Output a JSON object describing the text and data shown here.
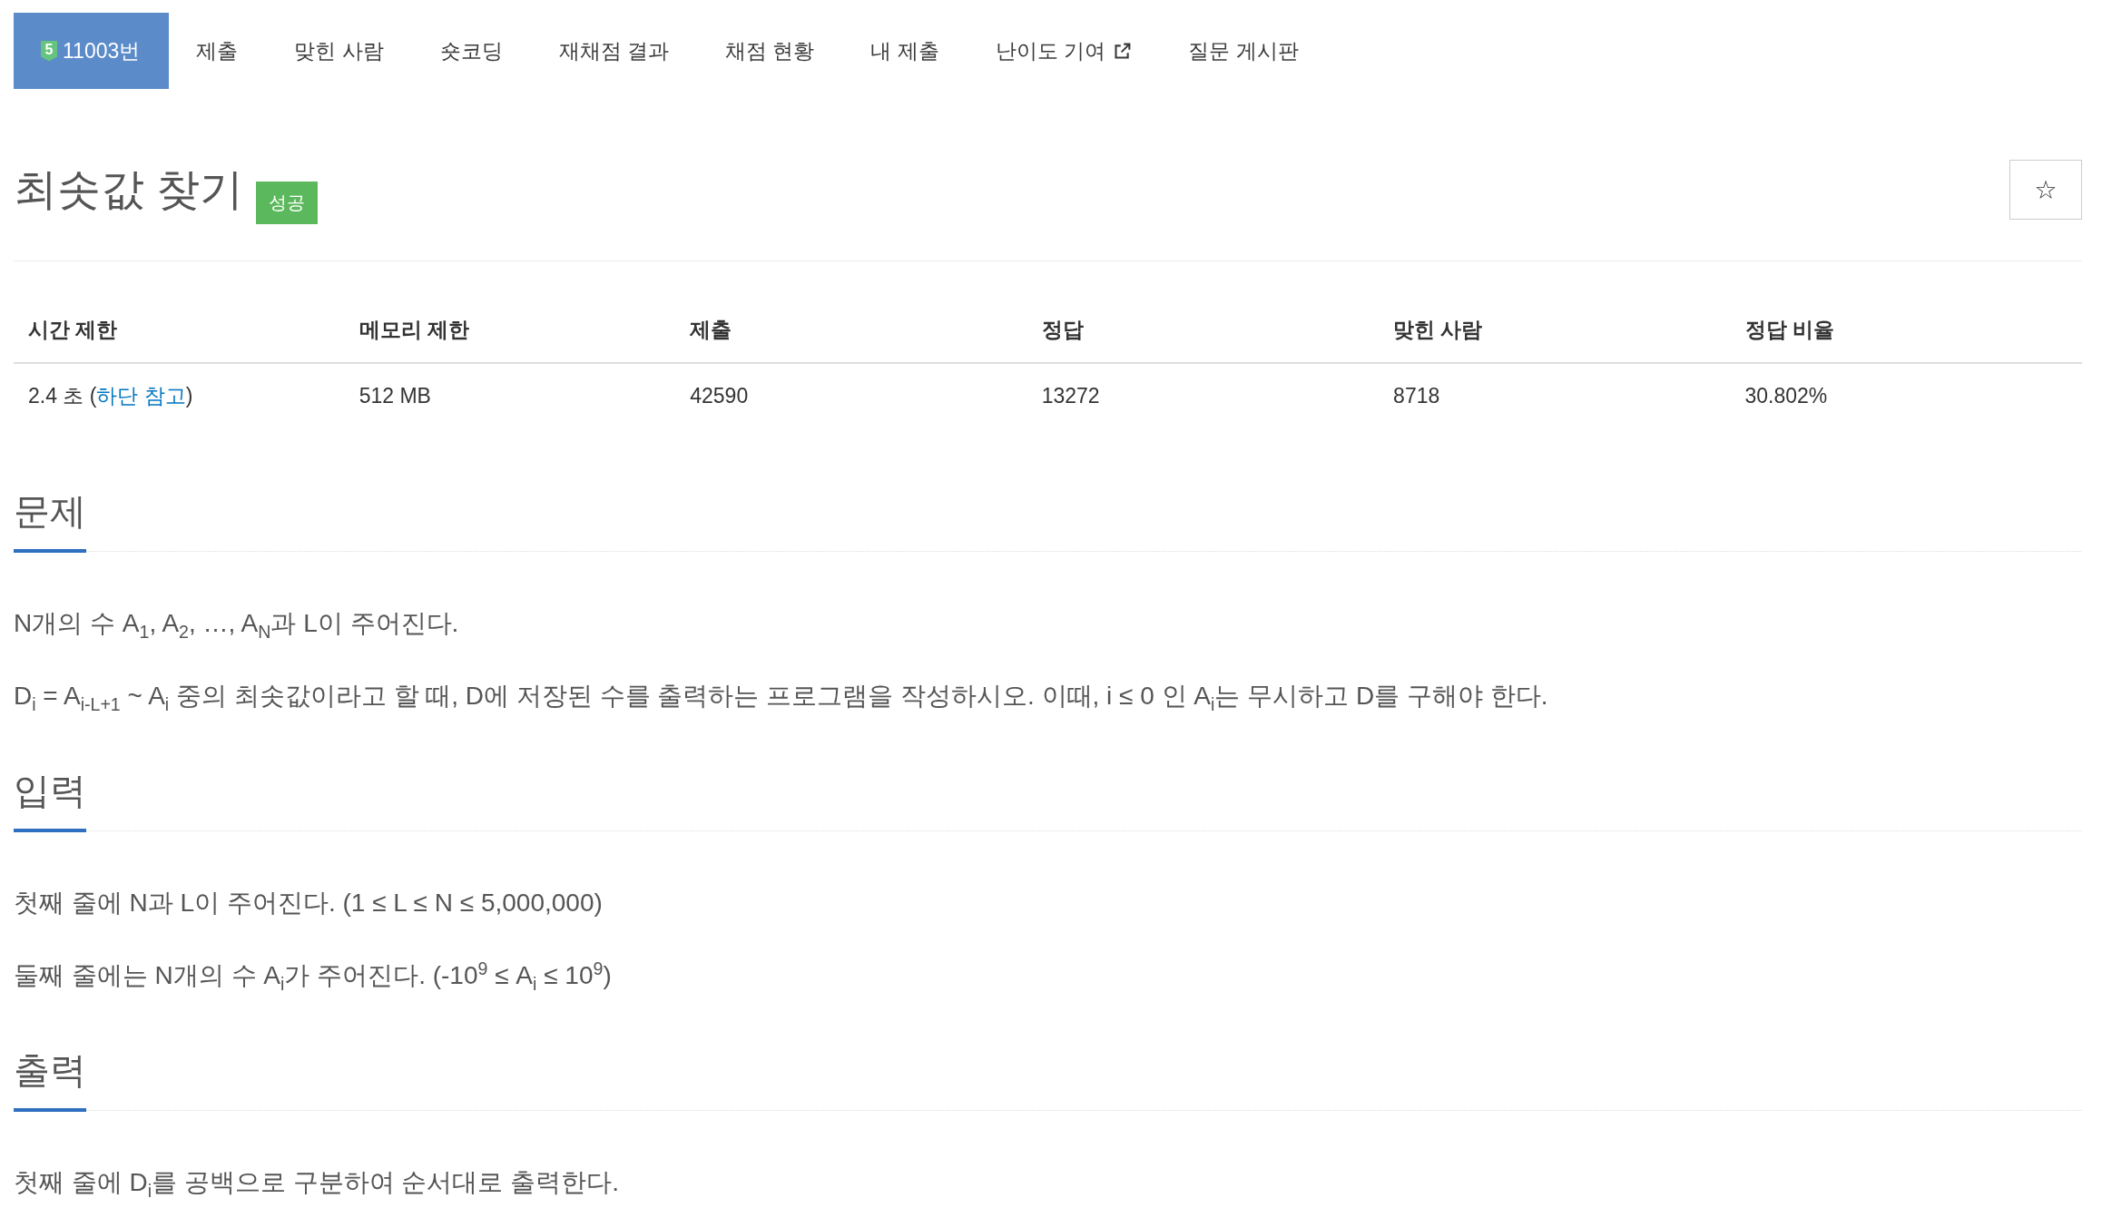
{
  "nav": {
    "tabs": [
      {
        "label": "11003번",
        "badge": "5",
        "selected": true
      },
      {
        "label": "제출",
        "selected": false
      },
      {
        "label": "맞힌 사람",
        "selected": false
      },
      {
        "label": "숏코딩",
        "selected": false
      },
      {
        "label": "재채점 결과",
        "selected": false
      },
      {
        "label": "채점 현황",
        "selected": false
      },
      {
        "label": "내 제출",
        "selected": false
      },
      {
        "label": "난이도 기여",
        "external": true,
        "selected": false
      },
      {
        "label": "질문 게시판",
        "selected": false
      }
    ]
  },
  "problem": {
    "title": "최솟값 찾기",
    "result": {
      "label": "성공",
      "kind": "success"
    },
    "star_button": {
      "label": "☆"
    }
  },
  "info_table": {
    "columns": [
      "시간 제한",
      "메모리 제한",
      "제출",
      "정답",
      "맞힌 사람",
      "정답 비율"
    ],
    "rows": [
      {
        "cells": [
          {
            "text": "2.4 초 (",
            "link": "하단 참고",
            "text_after": ")"
          },
          {
            "text": "512 MB"
          },
          {
            "text": "42590"
          },
          {
            "text": "13272"
          },
          {
            "text": "8718"
          },
          {
            "text": "30.802%"
          }
        ]
      }
    ]
  },
  "sections": [
    {
      "heading": "문제",
      "paragraphs": [
        "N개의 수 A$_{1}$, A$_{2}$, …, A$_{N}$과 L이 주어진다.",
        "D$_{i}$ = A$_{i-L+1}$ ~ A$_{i}$ 중의 최솟값이라고 할 때, D에 저장된 수를 출력하는 프로그램을 작성하시오. 이때, i ≤ 0 인 A$_{i}$는 무시하고 D를 구해야 한다."
      ]
    },
    {
      "heading": "입력",
      "paragraphs": [
        "첫째 줄에 N과 L이 주어진다. (1 ≤ L ≤ N ≤ 5,000,000)",
        "둘째 줄에는 N개의 수 A$_{i}$가 주어진다. (-10$^{9}$ ≤ A$_{i}$ ≤ 10$^{9}$)"
      ]
    },
    {
      "heading": "출력",
      "paragraphs": [
        "첫째 줄에 D$_{i}$를 공백으로 구분하여 순서대로 출력한다."
      ]
    }
  ]
}
